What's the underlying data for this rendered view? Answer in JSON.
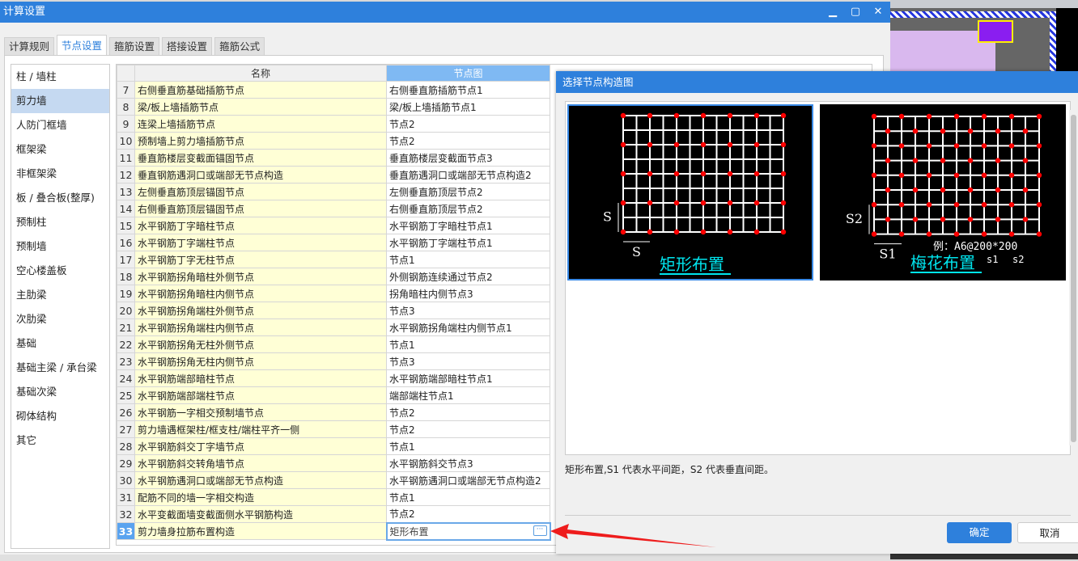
{
  "main_window": {
    "title": "计算设置",
    "tabs": [
      "计算规则",
      "节点设置",
      "箍筋设置",
      "搭接设置",
      "箍筋公式"
    ],
    "active_tab": 1,
    "sidebar": [
      "柱 / 墙柱",
      "剪力墙",
      "人防门框墙",
      "框架梁",
      "非框架梁",
      "板 / 叠合板(整厚)",
      "预制柱",
      "预制墙",
      "空心楼盖板",
      "主肋梁",
      "次肋梁",
      "基础",
      "基础主梁 / 承台梁",
      "基础次梁",
      "砌体结构",
      "其它"
    ],
    "sidebar_selected": 1,
    "table": {
      "headers": [
        "名称",
        "节点图"
      ],
      "rows": [
        {
          "no": "7",
          "name": "右侧垂直筋基础插筋节点",
          "node": "右侧垂直筋插筋节点1"
        },
        {
          "no": "8",
          "name": "梁/板上墙插筋节点",
          "node": "梁/板上墙插筋节点1"
        },
        {
          "no": "9",
          "name": "连梁上墙插筋节点",
          "node": "节点2"
        },
        {
          "no": "10",
          "name": "预制墙上剪力墙插筋节点",
          "node": "节点2"
        },
        {
          "no": "11",
          "name": "垂直筋楼层变截面锚固节点",
          "node": "垂直筋楼层变截面节点3"
        },
        {
          "no": "12",
          "name": "垂直钢筋遇洞口或端部无节点构造",
          "node": "垂直筋遇洞口或端部无节点构造2"
        },
        {
          "no": "13",
          "name": "左侧垂直筋顶层锚固节点",
          "node": "左侧垂直筋顶层节点2"
        },
        {
          "no": "14",
          "name": "右侧垂直筋顶层锚固节点",
          "node": "右侧垂直筋顶层节点2"
        },
        {
          "no": "15",
          "name": "水平钢筋丁字暗柱节点",
          "node": "水平钢筋丁字暗柱节点1"
        },
        {
          "no": "16",
          "name": "水平钢筋丁字端柱节点",
          "node": "水平钢筋丁字端柱节点1"
        },
        {
          "no": "17",
          "name": "水平钢筋丁字无柱节点",
          "node": "节点1"
        },
        {
          "no": "18",
          "name": "水平钢筋拐角暗柱外侧节点",
          "node": "外侧钢筋连续通过节点2"
        },
        {
          "no": "19",
          "name": "水平钢筋拐角暗柱内侧节点",
          "node": "拐角暗柱内侧节点3"
        },
        {
          "no": "20",
          "name": "水平钢筋拐角端柱外侧节点",
          "node": "节点3"
        },
        {
          "no": "21",
          "name": "水平钢筋拐角端柱内侧节点",
          "node": "水平钢筋拐角端柱内侧节点1"
        },
        {
          "no": "22",
          "name": "水平钢筋拐角无柱外侧节点",
          "node": "节点1"
        },
        {
          "no": "23",
          "name": "水平钢筋拐角无柱内侧节点",
          "node": "节点3"
        },
        {
          "no": "24",
          "name": "水平钢筋端部暗柱节点",
          "node": "水平钢筋端部暗柱节点1"
        },
        {
          "no": "25",
          "name": "水平钢筋端部端柱节点",
          "node": "端部端柱节点1"
        },
        {
          "no": "26",
          "name": "水平钢筋一字相交预制墙节点",
          "node": "节点2"
        },
        {
          "no": "27",
          "name": "剪力墙遇框架柱/框支柱/端柱平齐一侧",
          "node": "节点2"
        },
        {
          "no": "28",
          "name": "水平钢筋斜交丁字墙节点",
          "node": "节点1"
        },
        {
          "no": "29",
          "name": "水平钢筋斜交转角墙节点",
          "node": "水平钢筋斜交节点3"
        },
        {
          "no": "30",
          "name": "水平钢筋遇洞口或端部无节点构造",
          "node": "水平钢筋遇洞口或端部无节点构造2"
        },
        {
          "no": "31",
          "name": "配筋不同的墙一字相交构造",
          "node": "节点1"
        },
        {
          "no": "32",
          "name": "水平变截面墙变截面侧水平钢筋构造",
          "node": "节点2"
        },
        {
          "no": "33",
          "name": "剪力墙身拉筋布置构造",
          "node": "矩形布置"
        }
      ],
      "ellipsis": "···"
    }
  },
  "dialog": {
    "title": "选择节点构造图",
    "options": [
      {
        "label": "矩形布置",
        "dim_v": "S",
        "dim_h": "S",
        "selected": true
      },
      {
        "label": "梅花布置",
        "dim_v": "S2",
        "dim_h": "S1",
        "example": "例：A6@200*200",
        "s1": "s1",
        "s2": "s2",
        "selected": false
      }
    ],
    "description": "矩形布置,S1 代表水平间距，S2 代表垂直间距。",
    "ok": "确定",
    "cancel": "取消"
  },
  "colors": {
    "accent": "#2e80dc",
    "highlight": "#ffffd6",
    "rebar_dot": "#ff0000",
    "caption": "#00e5ee"
  }
}
